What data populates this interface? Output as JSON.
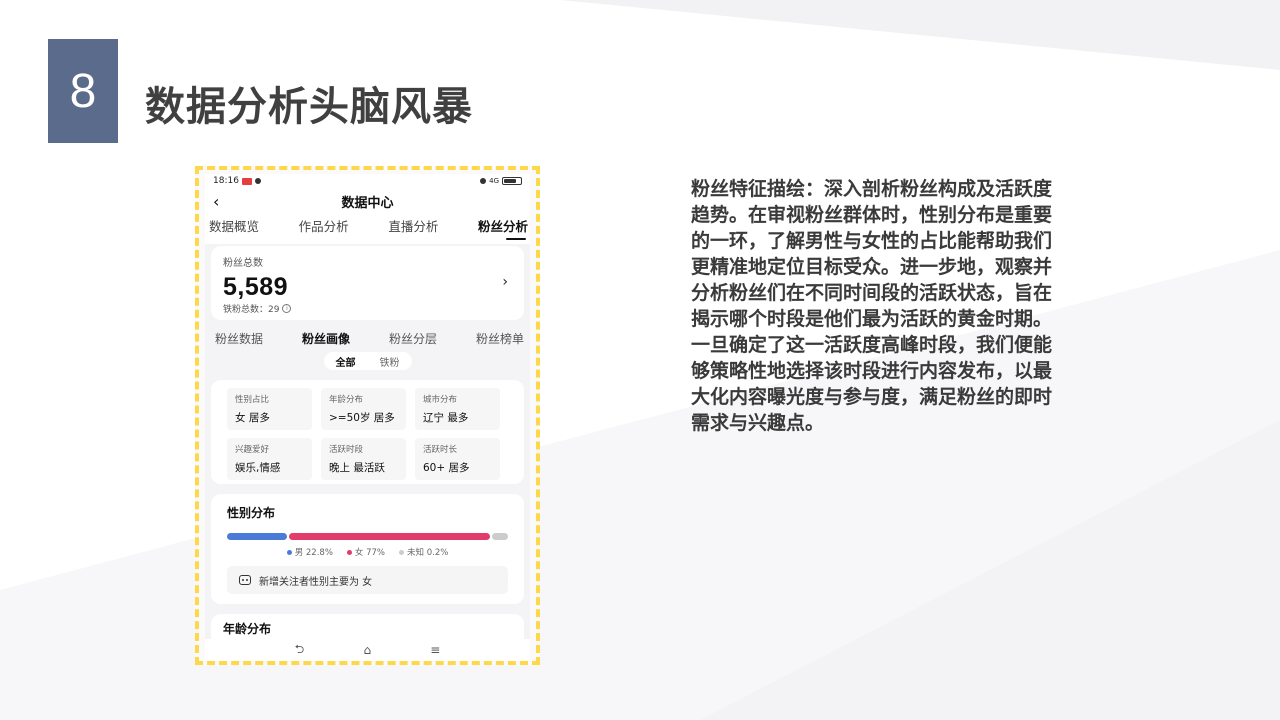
{
  "slide": {
    "number": "8",
    "title": "数据分析头脑风暴",
    "body": "粉丝特征描绘：深入剖析粉丝构成及活跃度趋势。在审视粉丝群体时，性别分布是重要的一环，了解男性与女性的占比能帮助我们更精准地定位目标受众。进一步地，观察并分析粉丝们在不同时间段的活跃状态，旨在揭示哪个时段是他们最为活跃的黄金时期。一旦确定了这一活跃度高峰时段，我们便能够策略性地选择该时段进行内容发布，以最大化内容曝光度与参与度，满足粉丝的即时需求与兴趣点。",
    "colors": {
      "number_box": "#5a6b8c",
      "frame_border": "#ffd84a",
      "title": "#404040"
    }
  },
  "phone": {
    "status": {
      "time": "18:16",
      "network": "4G",
      "battery": ""
    },
    "nav": {
      "back_icon": "‹",
      "title": "数据中心"
    },
    "main_tabs": [
      {
        "label": "数据概览",
        "active": false
      },
      {
        "label": "作品分析",
        "active": false
      },
      {
        "label": "直播分析",
        "active": false
      },
      {
        "label": "粉丝分析",
        "active": true
      }
    ],
    "total": {
      "label": "粉丝总数",
      "value": "5,589",
      "sub_label": "铁粉总数：29",
      "chevron": "›"
    },
    "sub_tabs": [
      {
        "label": "粉丝数据",
        "active": false
      },
      {
        "label": "粉丝画像",
        "active": true
      },
      {
        "label": "粉丝分层",
        "active": false
      },
      {
        "label": "粉丝榜单",
        "active": false
      }
    ],
    "segment": [
      {
        "label": "全部",
        "active": true
      },
      {
        "label": "铁粉",
        "active": false
      }
    ],
    "profile": [
      {
        "label": "性别占比",
        "value": "女 居多"
      },
      {
        "label": "年龄分布",
        "value": ">=50岁 居多"
      },
      {
        "label": "城市分布",
        "value": "辽宁 最多"
      },
      {
        "label": "兴趣爱好",
        "value": "娱乐,情感"
      },
      {
        "label": "活跃时段",
        "value": "晚上 最活跃"
      },
      {
        "label": "活跃时长",
        "value": "60+ 居多"
      }
    ],
    "gender": {
      "title": "性别分布",
      "male": {
        "label": "男 22.8%",
        "share": 22.8,
        "color": "#4a7bd9"
      },
      "female": {
        "label": "女 77%",
        "share": 77,
        "color": "#e23d6a"
      },
      "unknown": {
        "label": "未知 0.2%",
        "share": 0.2,
        "color": "#cccccc"
      },
      "note": "新增关注者性别主要为 女"
    },
    "age": {
      "title": "年龄分布"
    },
    "system_nav": {
      "back": "⮌",
      "home": "⌂",
      "menu": "≡"
    }
  }
}
